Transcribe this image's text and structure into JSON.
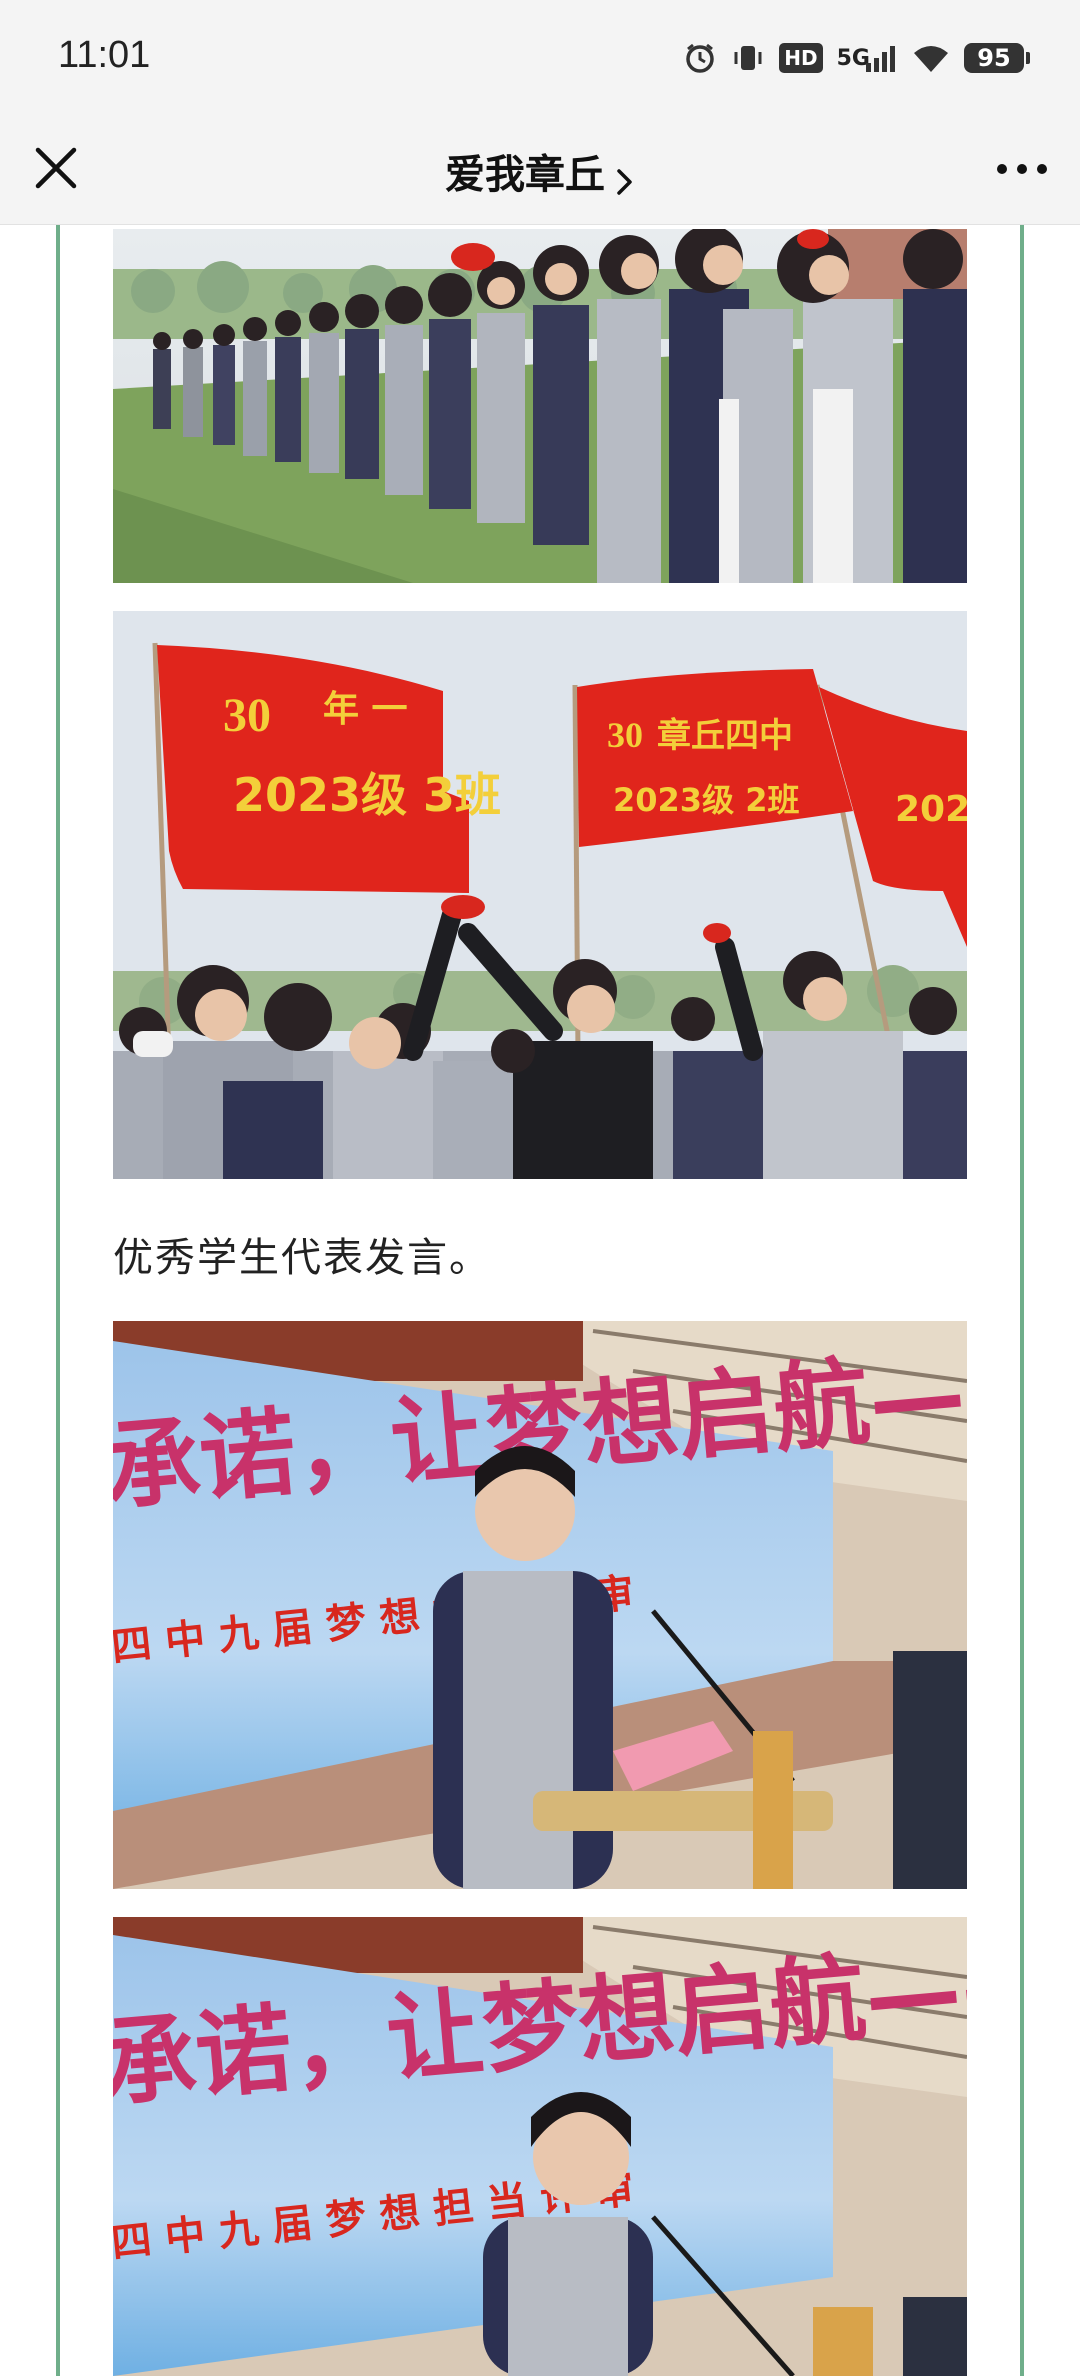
{
  "status_bar": {
    "time": "11:01",
    "hd": "HD",
    "network": "5G",
    "battery": "95"
  },
  "nav": {
    "title": "爱我章丘",
    "close_icon": "close-icon",
    "more_icon": "more-icon"
  },
  "article": {
    "caption": "优秀学生代表发言。",
    "photos": [
      {
        "name": "photo-students-line",
        "flag_texts": []
      },
      {
        "name": "photo-flags",
        "flag_texts": [
          "2023级  3班",
          "章丘四中",
          "2023级  2班",
          "202"
        ]
      },
      {
        "name": "photo-speaker-1",
        "banner_text": "承诺，让梦想启航——相约三十年",
        "banner_sub": "四 中 九 届 梦 想 担 当 评 审"
      },
      {
        "name": "photo-speaker-2",
        "banner_text": "承诺，让梦想启航——相约三十年",
        "banner_sub": "四 中 九 届 梦 想 担 当 评 审"
      }
    ]
  },
  "colors": {
    "frame": "#6fae8a",
    "flag_red": "#e0251c",
    "flag_text": "#f3cf3a"
  }
}
